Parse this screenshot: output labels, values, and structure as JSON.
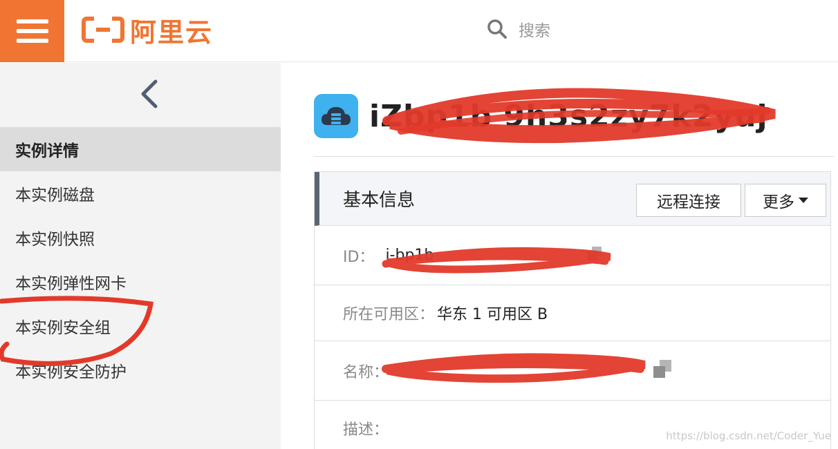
{
  "header": {
    "logo_text": "阿里云",
    "search_placeholder": "搜索",
    "brand_color": "#f07533"
  },
  "sidebar": {
    "items": [
      {
        "label": "实例详情",
        "active": true
      },
      {
        "label": "本实例磁盘"
      },
      {
        "label": "本实例快照"
      },
      {
        "label": "本实例弹性网卡"
      },
      {
        "label": "本实例安全组"
      },
      {
        "label": "本实例安全防护"
      }
    ]
  },
  "instance": {
    "title": "iZbp1b 9h3s2zy7k2yuj"
  },
  "basic_info": {
    "title": "基本信息",
    "remote_button": "远程连接",
    "more_button": "更多",
    "rows": [
      {
        "label": "ID：",
        "value": "i-bp1b"
      },
      {
        "label": "所在可用区：",
        "value": "华东 1 可用区 B"
      },
      {
        "label": "名称：",
        "value": ""
      },
      {
        "label": "描述：",
        "value": ""
      }
    ]
  },
  "watermark": "https://blog.csdn.net/Coder_Yue",
  "icons": {
    "menu": "menu-icon",
    "search": "search-icon",
    "back": "chevron-left-icon",
    "instance": "cloud-server-icon",
    "copy": "copy-icon"
  }
}
